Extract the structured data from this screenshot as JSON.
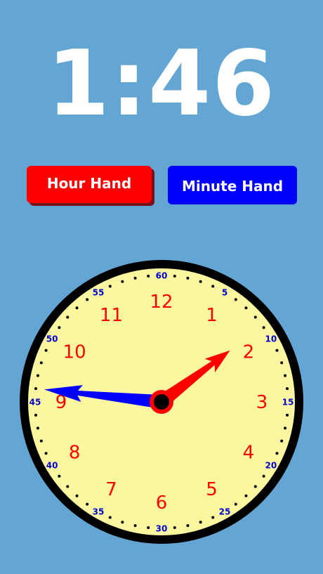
{
  "display": {
    "time": "1:46"
  },
  "buttons": {
    "hour_label": "Hour Hand",
    "minute_label": "Minute Hand"
  },
  "clock": {
    "hour_numbers": [
      "12",
      "1",
      "2",
      "3",
      "4",
      "5",
      "6",
      "7",
      "8",
      "9",
      "10",
      "11"
    ],
    "minute_labels": [
      "60",
      "5",
      "10",
      "15",
      "20",
      "25",
      "30",
      "35",
      "40",
      "45",
      "50",
      "55"
    ],
    "hour_hand_position_hours": 1.77,
    "minute_hand_position_minutes": 46,
    "colors": {
      "face": "#fbf7a1",
      "rim": "#000000",
      "hour_numbers": "#ff0000",
      "minute_labels": "#0000cc",
      "hour_hand": "#ff0000",
      "minute_hand": "#0000ff",
      "center_dot": "#000000",
      "center_ring": "#ff0000"
    }
  }
}
